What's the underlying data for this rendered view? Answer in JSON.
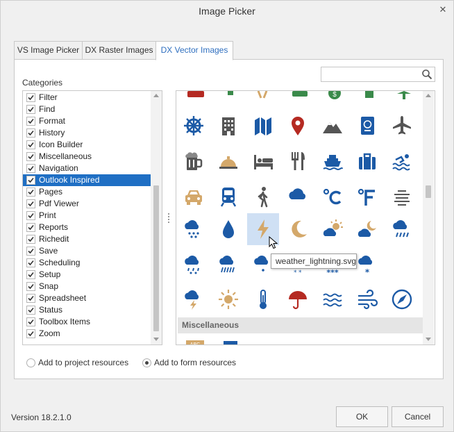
{
  "window": {
    "title": "Image Picker"
  },
  "tabs": [
    {
      "label": "VS Image Picker",
      "active": false
    },
    {
      "label": "DX Raster Images",
      "active": false
    },
    {
      "label": "DX Vector Images",
      "active": true
    }
  ],
  "search": {
    "value": "",
    "placeholder": ""
  },
  "categories": {
    "label": "Categories",
    "items": [
      {
        "label": "Filter",
        "checked": true
      },
      {
        "label": "Find",
        "checked": true
      },
      {
        "label": "Format",
        "checked": true
      },
      {
        "label": "History",
        "checked": true
      },
      {
        "label": "Icon Builder",
        "checked": true
      },
      {
        "label": "Miscellaneous",
        "checked": true
      },
      {
        "label": "Navigation",
        "checked": true
      },
      {
        "label": "Outlook Inspired",
        "checked": true,
        "selected": true
      },
      {
        "label": "Pages",
        "checked": true
      },
      {
        "label": "Pdf Viewer",
        "checked": true
      },
      {
        "label": "Print",
        "checked": true
      },
      {
        "label": "Reports",
        "checked": true
      },
      {
        "label": "Richedit",
        "checked": true
      },
      {
        "label": "Save",
        "checked": true
      },
      {
        "label": "Scheduling",
        "checked": true
      },
      {
        "label": "Setup",
        "checked": true
      },
      {
        "label": "Snap",
        "checked": true
      },
      {
        "label": "Spreadsheet",
        "checked": true
      },
      {
        "label": "Status",
        "checked": true
      },
      {
        "label": "Toolbox Items",
        "checked": true
      },
      {
        "label": "Zoom",
        "checked": true
      }
    ]
  },
  "gallery": {
    "group_header": "Miscellaneous",
    "tooltip": "weather_lightning.svg",
    "hovered_icon": "weather-lightning-icon",
    "colors": {
      "blue": "#1c5aa6",
      "dark": "#555555",
      "red": "#b52a22",
      "tan": "#d4a86a",
      "green": "#3a8a4a"
    },
    "rows": [
      [
        "ship-wheel-icon",
        "office-building-icon",
        "map-icon",
        "map-pin-icon",
        "mountains-icon",
        "passport-icon",
        "airplane-icon"
      ],
      [
        "beer-mug-icon",
        "service-bell-icon",
        "hotel-bed-icon",
        "restaurant-icon",
        "cruise-ship-icon",
        "suitcase-icon",
        "swimming-icon"
      ],
      [
        "taxi-icon",
        "train-icon",
        "walking-person-icon",
        "cloud-icon",
        "celsius-icon",
        "fahrenheit-icon",
        "fog-icon"
      ],
      [
        "hail-cloud-icon",
        "raindrop-icon",
        "weather-lightning-icon",
        "moon-icon",
        "partly-sunny-icon",
        "partly-cloudy-night-icon",
        "rain-cloud-icon"
      ],
      [
        "sleet-cloud-icon",
        "heavy-rain-icon",
        "snow-rain-icon",
        "snow-cloud-icon",
        "heavy-snow-icon",
        "snowflake-cloud-icon",
        ""
      ],
      [
        "thunderstorm-icon",
        "sun-icon",
        "thermometer-icon",
        "umbrella-icon",
        "waves-icon",
        "wind-icon",
        "compass-icon"
      ]
    ]
  },
  "resources": {
    "options": [
      {
        "label": "Add to project resources",
        "checked": false
      },
      {
        "label": "Add to form resources",
        "checked": true
      }
    ]
  },
  "footer": {
    "version": "Version 18.2.1.0",
    "ok_label": "OK",
    "cancel_label": "Cancel"
  }
}
